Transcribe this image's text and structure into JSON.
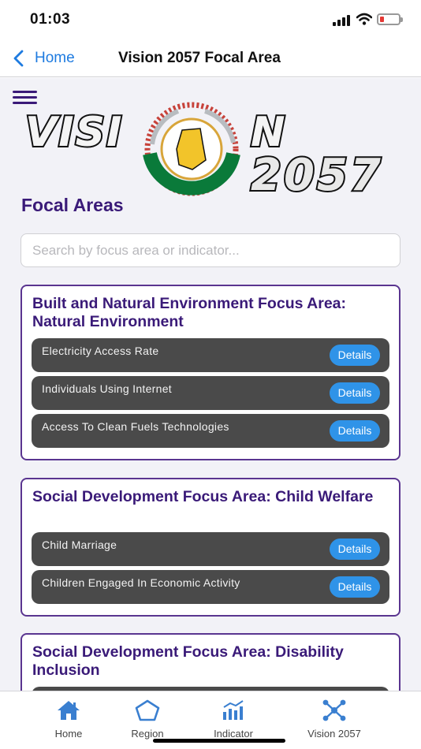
{
  "status_bar": {
    "time": "01:03"
  },
  "nav": {
    "back_label": "Home",
    "title": "Vision 2057 Focal Area"
  },
  "logo": {
    "text_left": "VISI",
    "text_right": "N",
    "text_year": "2057"
  },
  "main": {
    "section_title": "Focal Areas",
    "search_placeholder": "Search by focus area or indicator...",
    "details_label": "Details",
    "cards": [
      {
        "title": "Built and Natural Environment Focus Area: Natural Environment",
        "indicators": [
          "Electricity Access Rate",
          "Individuals Using Internet",
          "Access To Clean Fuels Technologies"
        ]
      },
      {
        "title": "Social Development Focus Area: Child Welfare",
        "indicators": [
          "Child Marriage",
          "Children Engaged In Economic Activity"
        ]
      },
      {
        "title": "Social Development Focus Area: Disability Inclusion",
        "indicators": []
      }
    ]
  },
  "tabs": [
    {
      "label": "Home",
      "icon": "home-icon"
    },
    {
      "label": "Region",
      "icon": "pentagon-icon"
    },
    {
      "label": "Indicator",
      "icon": "chart-icon"
    },
    {
      "label": "Vision 2057",
      "icon": "network-icon"
    }
  ],
  "colors": {
    "accent": "#3a1a78",
    "button": "#2f93e8",
    "tab_icon": "#3a7fd0",
    "row": "#4a4a4a"
  }
}
